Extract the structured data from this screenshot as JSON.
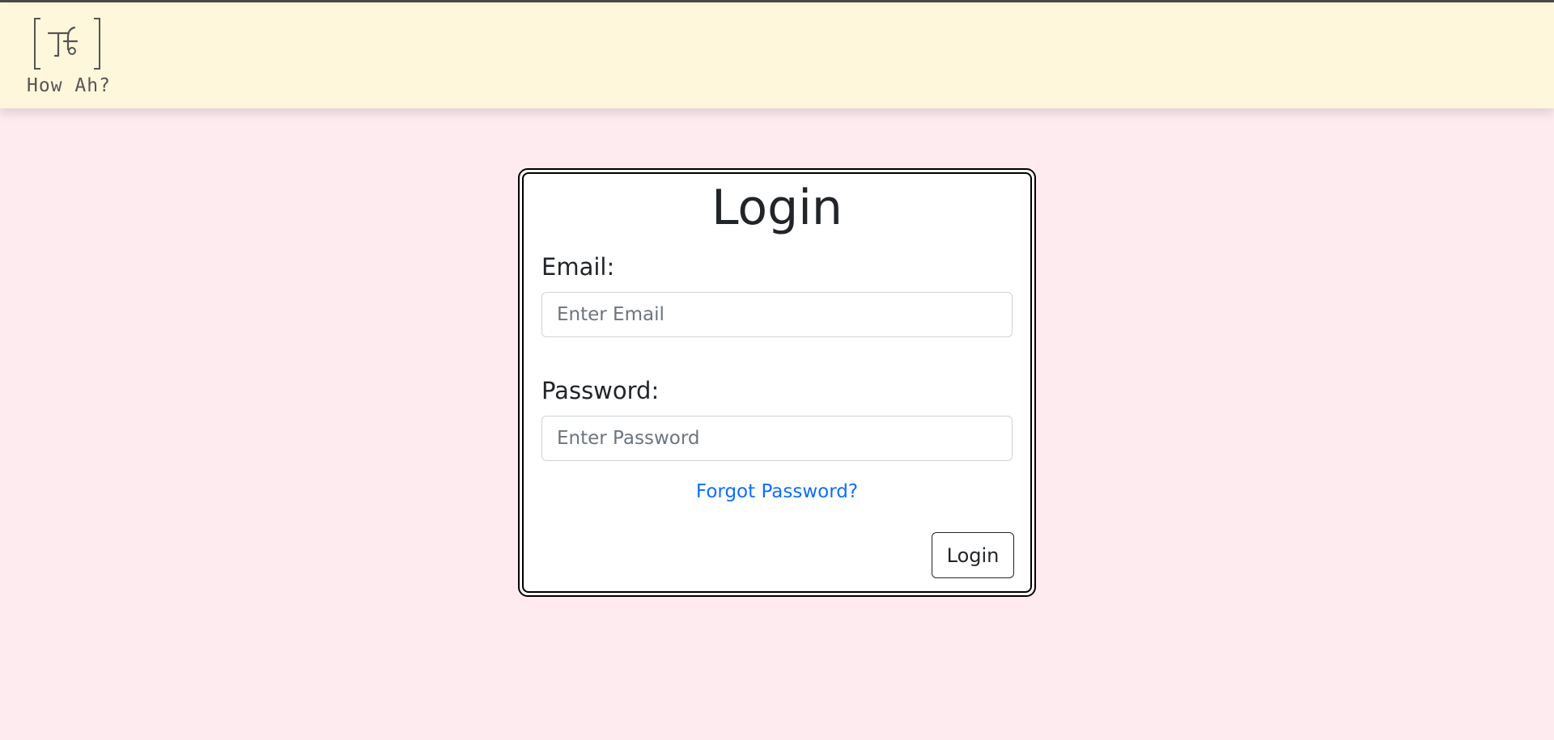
{
  "header": {
    "brand_name": "How Ah?"
  },
  "login": {
    "title": "Login",
    "email_label": "Email:",
    "email_placeholder": "Enter Email",
    "email_value": "",
    "password_label": "Password:",
    "password_placeholder": "Enter Password",
    "password_value": "",
    "forgot_link": "Forgot Password?",
    "submit_label": "Login"
  },
  "colors": {
    "page_background": "#fdebef",
    "header_background": "#fff7db",
    "link": "#0d6efd"
  },
  "icons": {
    "logo": "bracketed-tf-logo-icon"
  }
}
